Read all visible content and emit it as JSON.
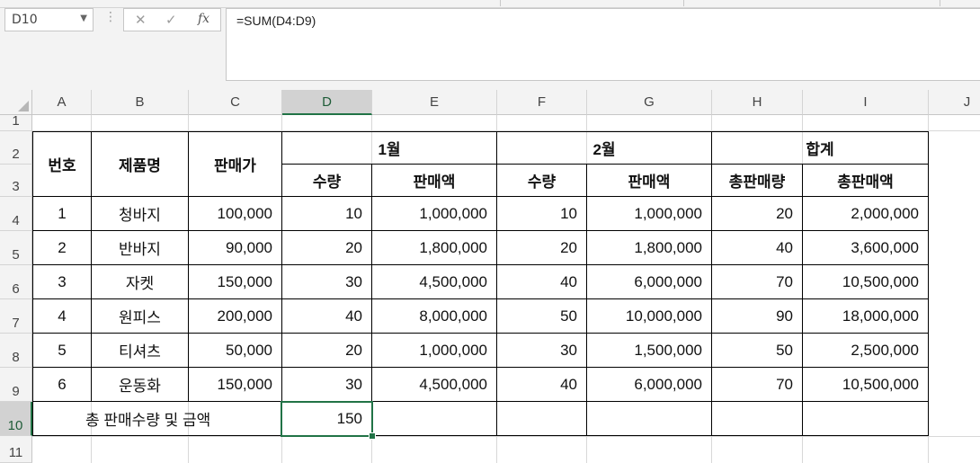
{
  "formula_bar": {
    "name_box": "D10",
    "cancel_icon": "✕",
    "enter_icon": "✓",
    "fx_label": "fx",
    "formula": "=SUM(D4:D9)"
  },
  "columns": [
    "A",
    "B",
    "C",
    "D",
    "E",
    "F",
    "G",
    "H",
    "I",
    "J"
  ],
  "selected_column": "D",
  "rows": [
    "1",
    "2",
    "3",
    "4",
    "5",
    "6",
    "7",
    "8",
    "9",
    "10",
    "11"
  ],
  "selected_row": "10",
  "table": {
    "headers": {
      "no": "번호",
      "product": "제품명",
      "price": "판매가",
      "jan": "1월",
      "feb": "2월",
      "total": "합계",
      "jan_qty": "수량",
      "jan_amount": "판매액",
      "feb_qty": "수량",
      "feb_amount": "판매액",
      "total_qty": "총판매량",
      "total_amount": "총판매액"
    },
    "data": [
      [
        "1",
        "청바지",
        "100,000",
        "10",
        "1,000,000",
        "10",
        "1,000,000",
        "20",
        "2,000,000"
      ],
      [
        "2",
        "반바지",
        "90,000",
        "20",
        "1,800,000",
        "20",
        "1,800,000",
        "40",
        "3,600,000"
      ],
      [
        "3",
        "자켓",
        "150,000",
        "30",
        "4,500,000",
        "40",
        "6,000,000",
        "70",
        "10,500,000"
      ],
      [
        "4",
        "원피스",
        "200,000",
        "40",
        "8,000,000",
        "50",
        "10,000,000",
        "90",
        "18,000,000"
      ],
      [
        "5",
        "티셔츠",
        "50,000",
        "20",
        "1,000,000",
        "30",
        "1,500,000",
        "50",
        "2,500,000"
      ],
      [
        "6",
        "운동화",
        "150,000",
        "30",
        "4,500,000",
        "40",
        "6,000,000",
        "70",
        "10,500,000"
      ]
    ],
    "summary_label": "총 판매수량 및 금액",
    "summary_value": "150"
  }
}
